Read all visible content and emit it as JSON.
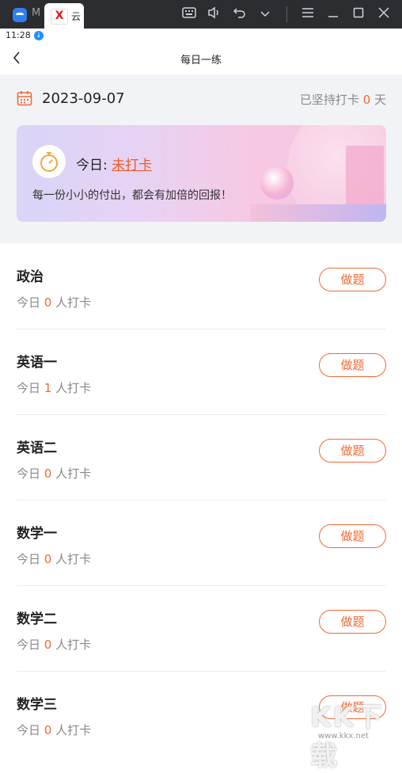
{
  "window": {
    "tab1_label": "M",
    "tab2_label": "云",
    "tab2_icon": "X"
  },
  "status_bar": {
    "time": "11:28"
  },
  "nav": {
    "title": "每日一练"
  },
  "header": {
    "date": "2023-09-07",
    "streak_prefix": "已坚持打卡",
    "streak_days": "0",
    "streak_suffix": "天"
  },
  "banner": {
    "today_label": "今日:",
    "today_status": "未打卡",
    "motto": "每一份小小的付出，都会有加倍的回报！"
  },
  "subjects": [
    {
      "name": "政治",
      "count_prefix": "今日",
      "count": "0",
      "count_suffix": "人打卡",
      "button": "做题"
    },
    {
      "name": "英语一",
      "count_prefix": "今日",
      "count": "1",
      "count_suffix": "人打卡",
      "button": "做题"
    },
    {
      "name": "英语二",
      "count_prefix": "今日",
      "count": "0",
      "count_suffix": "人打卡",
      "button": "做题"
    },
    {
      "name": "数学一",
      "count_prefix": "今日",
      "count": "0",
      "count_suffix": "人打卡",
      "button": "做题"
    },
    {
      "name": "数学二",
      "count_prefix": "今日",
      "count": "0",
      "count_suffix": "人打卡",
      "button": "做题"
    },
    {
      "name": "数学三",
      "count_prefix": "今日",
      "count": "0",
      "count_suffix": "人打卡",
      "button": "做题"
    }
  ],
  "watermark": {
    "text": "KK下载",
    "url": "www.kkx.net"
  },
  "colors": {
    "accent": "#f06a35",
    "status_red": "#ef5a23"
  },
  "icons": [
    "keyboard-icon",
    "volume-icon",
    "undo-icon",
    "chevron-down-icon",
    "menu-icon",
    "minimize-icon",
    "maximize-icon",
    "close-icon",
    "back-arrow-icon",
    "calendar-icon",
    "stopwatch-icon"
  ]
}
